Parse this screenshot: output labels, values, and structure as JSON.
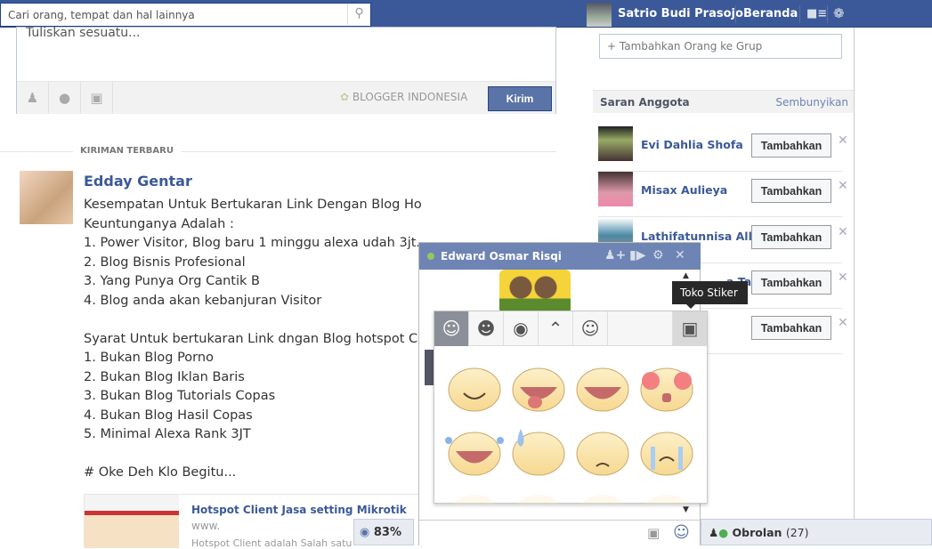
{
  "topbar": {
    "search_placeholder": "Cari orang, tempat dan hal lainnya",
    "user_name": "Satrio Budi Prasojo",
    "home": "Beranda",
    "brand_color": "#3b5998"
  },
  "composer": {
    "placeholder": "Tuliskan sesuatu...",
    "privacy_label": "BLOGGER INDONESIA",
    "submit": "Kirim"
  },
  "feed": {
    "section_label": "KIRIMAN TERBARU",
    "post": {
      "author": "Edday Gentar",
      "body": "Kesempatan Untuk Bertukaran Link Dengan Blog Hotspot Client.\nKeuntunganya Adalah :\n1. Power Visitor, Blog baru 1 minggu alexa udah 3jt.\n2. Blog Bisnis Profesional\n3. Yang Punya Org Cantik B\n4. Blog anda akan kebanjuran Visitor\n\nSyarat Untuk bertukaran Link dngan Blog hotspot Client\n1. Bukan Blog Porno\n2. Bukan Blog Iklan Baris\n3. Bukan Blog Tutorials Copas\n4. Bukan Blog Hasil Copas\n5. Minimal Alexa Rank 3JT\n\n# Oke Deh Klo Begitu...",
      "link": {
        "title": "Hotspot Client Jasa setting Mikrotik",
        "url": "www.",
        "description": "Hotspot Client adalah Salah satu"
      }
    }
  },
  "status_badge": {
    "value": "83%"
  },
  "right": {
    "add_people": "Tambahkan Orang ke Grup",
    "suggestions_title": "Saran Anggota",
    "hide": "Sembunyikan",
    "suggestions": [
      {
        "name": "Evi Dahlia Shofa",
        "button": "Tambahkan"
      },
      {
        "name": "Misax Aulieya",
        "button": "Tambahkan"
      },
      {
        "name": "Lathifatunnisa Allf",
        "button": "Tambahkan"
      },
      {
        "name": "a Tahmi",
        "button": "Tambahkan"
      },
      {
        "name": "",
        "button": "Tambahkan"
      }
    ]
  },
  "chat": {
    "name": "Edward Osmar Risqi",
    "online_color": "#8fcb5b",
    "header_color": "#6d84b4"
  },
  "sticker_panel": {
    "tooltip": "Toko Stiker",
    "tabs": [
      "smiley-pack",
      "girl-pack",
      "minion-pack",
      "cat-pack",
      "emoji-pack"
    ]
  },
  "chat_bar": {
    "label": "Obrolan",
    "count": "(27)"
  }
}
